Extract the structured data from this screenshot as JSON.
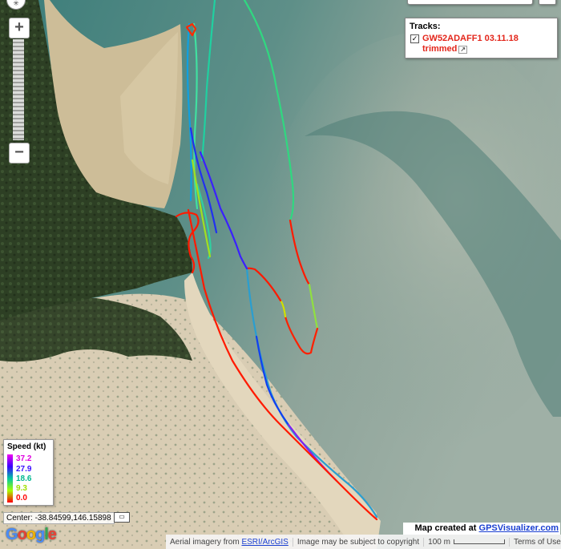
{
  "tracks_panel": {
    "header": "Tracks:",
    "checked": true,
    "track_name": "GW52ADAFF1 03.11.18 trimmed",
    "track_color": "#e3261b"
  },
  "zoom": {
    "plus": "+",
    "minus": "−"
  },
  "legend": {
    "title": "Speed (kt)",
    "entries": [
      {
        "label": "37.2",
        "color": "#e000e0"
      },
      {
        "label": "27.9",
        "color": "#3a10ff"
      },
      {
        "label": "18.6",
        "color": "#00b890"
      },
      {
        "label": "9.3",
        "color": "#a0e000"
      },
      {
        "label": "0.0",
        "color": "#ff0000"
      }
    ]
  },
  "center": "Center: -38.84599,146.15898",
  "ruler_icon": "ruler-icon",
  "google_logo": [
    "G",
    "o",
    "o",
    "g",
    "l",
    "e"
  ],
  "attribution": {
    "prefix": "Aerial imagery from ",
    "link": "ESRI/ArcGIS",
    "copyright": "Image may be subject to copyright",
    "scale": "100 m",
    "terms": "Terms of Use"
  },
  "credit": {
    "prefix": "Map created at ",
    "link": "GPSVisualizer.com"
  },
  "colors": {
    "water_dark": "#2f6e6e",
    "water_light": "#a8b6ac",
    "sand": "#d6c7a8",
    "vegetation": "#2f4226"
  }
}
